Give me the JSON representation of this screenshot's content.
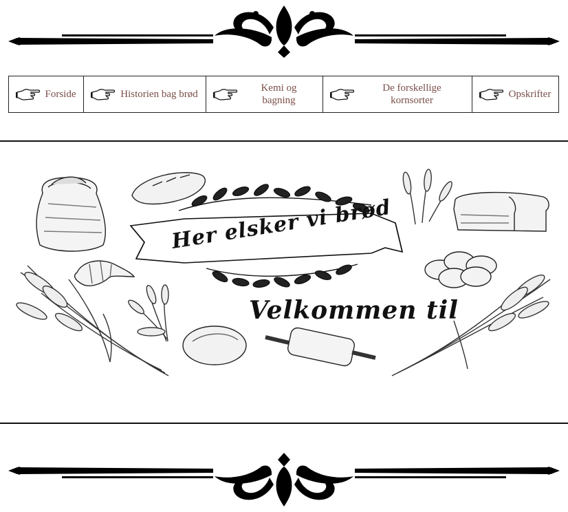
{
  "nav": {
    "items": [
      {
        "label": "Forside"
      },
      {
        "label": "Historien bag brød"
      },
      {
        "label": "Kemi og bagning"
      },
      {
        "label": "De forskellige kornsorter"
      },
      {
        "label": "Opskrifter"
      }
    ]
  },
  "hero": {
    "banner_text": "Her elsker vi brød",
    "welcome_text": "Velkommen til"
  },
  "icons": {
    "nav_icon": "pointing-hand-icon",
    "divider_icon": "ornamental-flourish-icon"
  }
}
